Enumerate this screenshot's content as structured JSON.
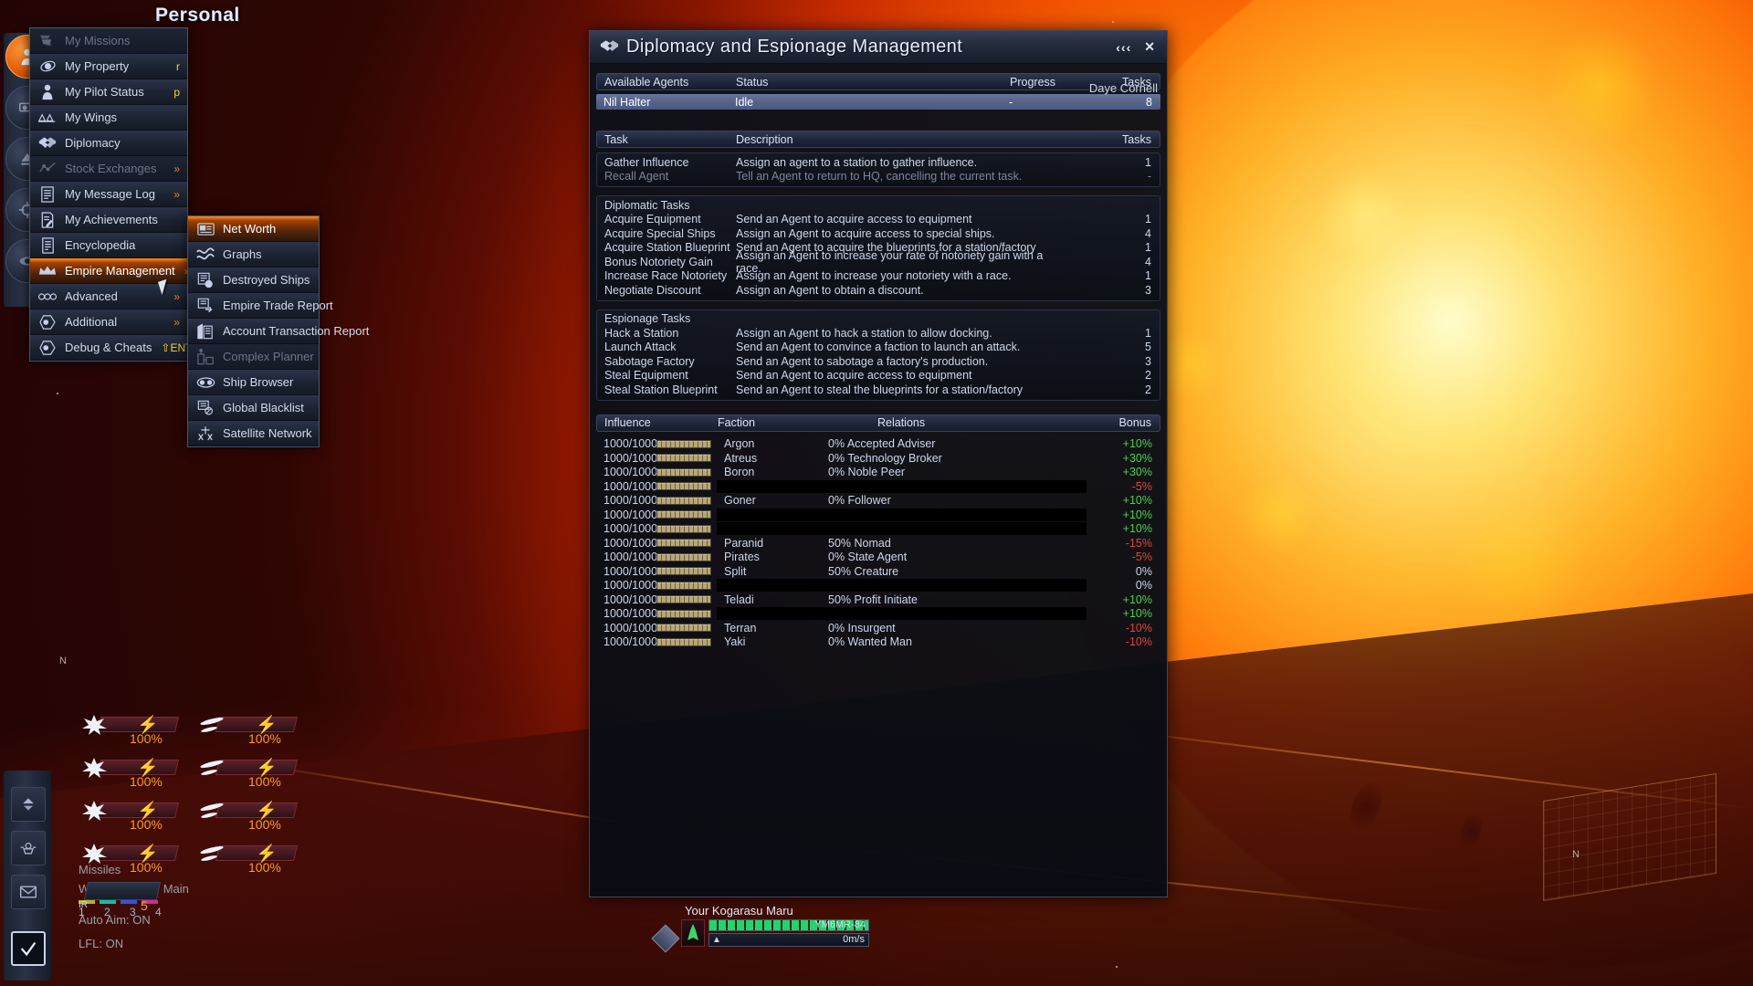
{
  "hud": {
    "personal_title": "Personal",
    "rail_top_icons": [
      "pilot-icon",
      "property-icon",
      "ship-icon",
      "target-icon",
      "galaxy-icon"
    ],
    "rail_bottom_icons": [
      "up-down-icon",
      "satellite-icon",
      "mail-icon",
      "checkbox-icon"
    ],
    "weapons": {
      "group_label": "Weapons",
      "main_label": "Main",
      "cells": [
        {
          "pct": "100%",
          "icon": "impulse-gun-icon"
        },
        {
          "pct": "100%",
          "icon": "beam-gun-icon"
        },
        {
          "pct": "100%",
          "icon": "impulse-gun-icon"
        },
        {
          "pct": "100%",
          "icon": "beam-gun-icon"
        },
        {
          "pct": "100%",
          "icon": "impulse-gun-icon"
        },
        {
          "pct": "100%",
          "icon": "beam-gun-icon"
        },
        {
          "pct": "100%",
          "icon": "impulse-gun-icon"
        },
        {
          "pct": "100%",
          "icon": "beam-gun-icon"
        }
      ],
      "slot_numbers": [
        "1",
        "2",
        "3",
        "4"
      ],
      "slot_colors": [
        "#b6b12a",
        "#1fb9a0",
        "#3a51d8",
        "#cc2e8e"
      ]
    },
    "missiles": {
      "label": "Missiles",
      "type": "IR",
      "count": "5"
    },
    "auto_aim": "Auto Aim: ON",
    "lfl": "LFL: ON",
    "ship": {
      "name": "Your Kogarasu Maru",
      "id": "YM6MR-84",
      "speed": "0m/s"
    },
    "markers": {
      "n_left": "N",
      "n_right": "N"
    }
  },
  "main_menu": {
    "items": [
      {
        "label": "My Missions",
        "icon": "missions-icon",
        "right": "",
        "arrow": "",
        "state": "disabled"
      },
      {
        "label": "My Property",
        "icon": "property-icon",
        "right": "r",
        "arrow": "",
        "state": "normal"
      },
      {
        "label": "My Pilot Status",
        "icon": "pilot-icon",
        "right": "p",
        "arrow": "",
        "state": "normal"
      },
      {
        "label": "My Wings",
        "icon": "wings-icon",
        "right": "",
        "arrow": "",
        "state": "normal"
      },
      {
        "label": "Diplomacy",
        "icon": "handshake-icon",
        "right": "",
        "arrow": "",
        "state": "normal"
      },
      {
        "label": "Stock Exchanges",
        "icon": "chart-icon",
        "right": "",
        "arrow": "»",
        "state": "disabled"
      },
      {
        "label": "My Message Log",
        "icon": "log-icon",
        "right": "",
        "arrow": "»",
        "state": "normal"
      },
      {
        "label": "My Achievements",
        "icon": "achievement-icon",
        "right": "",
        "arrow": "",
        "state": "normal"
      },
      {
        "label": "Encyclopedia",
        "icon": "book-icon",
        "right": "",
        "arrow": "",
        "state": "normal"
      },
      {
        "label": "Empire Management",
        "icon": "crown-icon",
        "right": "",
        "arrow": "»",
        "state": "highlight"
      },
      {
        "label": "Advanced",
        "icon": "dots-icon",
        "right": "",
        "arrow": "»",
        "state": "normal"
      },
      {
        "label": "Additional",
        "icon": "hex-icon",
        "right": "",
        "arrow": "»",
        "state": "normal"
      },
      {
        "label": "Debug & Cheats",
        "icon": "hex-icon",
        "right": "⇧ENTER (TN)",
        "arrow": "",
        "state": "normal"
      }
    ]
  },
  "sub_menu": {
    "items": [
      {
        "label": "Net Worth",
        "icon": "networth-icon",
        "state": "highlight"
      },
      {
        "label": "Graphs",
        "icon": "graphs-icon",
        "state": "normal"
      },
      {
        "label": "Destroyed Ships",
        "icon": "destroyed-icon",
        "state": "normal"
      },
      {
        "label": "Empire Trade Report",
        "icon": "trade-icon",
        "state": "normal"
      },
      {
        "label": "Account Transaction Report",
        "icon": "account-icon",
        "state": "normal"
      },
      {
        "label": "Complex Planner",
        "icon": "complex-icon",
        "state": "disabled"
      },
      {
        "label": "Ship Browser",
        "icon": "shipbrowser-icon",
        "state": "normal"
      },
      {
        "label": "Global Blacklist",
        "icon": "blacklist-icon",
        "state": "normal"
      },
      {
        "label": "Satellite Network",
        "icon": "satellite-icon",
        "state": "normal"
      }
    ]
  },
  "dialog": {
    "title": "Diplomacy and Espionage Management",
    "title_icon": "handshake-icon",
    "collapse_glyph": "‹‹‹",
    "close_glyph": "✕",
    "user": "Daye Cornell",
    "agents": {
      "headers": [
        "Available Agents",
        "Status",
        "Progress",
        "Tasks"
      ],
      "rows": [
        {
          "name": "Nil Halter",
          "status": "Idle",
          "progress": "-",
          "tasks": "8",
          "selected": true
        }
      ]
    },
    "tasks": {
      "headers": [
        "Task",
        "Description",
        "",
        "Tasks"
      ],
      "general": [
        {
          "task": "Gather Influence",
          "desc": "Assign an agent to a station to gather influence.",
          "tasks": "1",
          "dim": false
        },
        {
          "task": "Recall Agent",
          "desc": "Tell an Agent to return to HQ, cancelling the current task.",
          "tasks": "-",
          "dim": true
        }
      ],
      "diplomatic_label": "Diplomatic Tasks",
      "diplomatic": [
        {
          "task": "Acquire Equipment",
          "desc": "Send an Agent to acquire access to equipment",
          "tasks": "1"
        },
        {
          "task": "Acquire Special Ships",
          "desc": "Assign an Agent to acquire access to special ships.",
          "tasks": "4"
        },
        {
          "task": "Acquire Station Blueprint",
          "desc": "Send an Agent to acquire the blueprints for a station/factory",
          "tasks": "1"
        },
        {
          "task": "Bonus Notoriety Gain",
          "desc": "Assign an Agent to increase your rate of notoriety gain with a race.",
          "tasks": "4"
        },
        {
          "task": "Increase Race Notoriety",
          "desc": "Assign an Agent to increase your notoriety with a race.",
          "tasks": "1"
        },
        {
          "task": "Negotiate Discount",
          "desc": "Assign an Agent to obtain a discount.",
          "tasks": "3"
        }
      ],
      "espionage_label": "Espionage Tasks",
      "espionage": [
        {
          "task": "Hack a Station",
          "desc": "Assign an Agent to hack a station to allow docking.",
          "tasks": "1"
        },
        {
          "task": "Launch Attack",
          "desc": "Send an Agent to convince a faction to launch an attack.",
          "tasks": "5"
        },
        {
          "task": "Sabotage Factory",
          "desc": "Send an Agent to sabotage a factory's production.",
          "tasks": "3"
        },
        {
          "task": "Steal Equipment",
          "desc": "Send an Agent to acquire access to equipment",
          "tasks": "2"
        },
        {
          "task": "Steal Station Blueprint",
          "desc": "Send an Agent to steal the blueprints for a station/factory",
          "tasks": "2"
        }
      ]
    },
    "influence": {
      "headers": [
        "Influence",
        "Faction",
        "Relations",
        "Bonus"
      ],
      "rows": [
        {
          "influence": "1000/1000",
          "bar": 100,
          "faction": "Argon",
          "relations": "0% Accepted Adviser",
          "bonus": "+10%",
          "bonus_sign": "pos",
          "redacted": false
        },
        {
          "influence": "1000/1000",
          "bar": 100,
          "faction": "Atreus",
          "relations": "0% Technology Broker",
          "bonus": "+30%",
          "bonus_sign": "pos",
          "redacted": false
        },
        {
          "influence": "1000/1000",
          "bar": 100,
          "faction": "Boron",
          "relations": "0% Noble Peer",
          "bonus": "+30%",
          "bonus_sign": "pos",
          "redacted": false
        },
        {
          "influence": "1000/1000",
          "bar": 100,
          "faction": "",
          "relations": "",
          "bonus": "-5%",
          "bonus_sign": "neg",
          "redacted": true
        },
        {
          "influence": "1000/1000",
          "bar": 100,
          "faction": "Goner",
          "relations": "0% Follower",
          "bonus": "+10%",
          "bonus_sign": "pos",
          "redacted": false
        },
        {
          "influence": "1000/1000",
          "bar": 100,
          "faction": "",
          "relations": "",
          "bonus": "+10%",
          "bonus_sign": "pos",
          "redacted": true
        },
        {
          "influence": "1000/1000",
          "bar": 100,
          "faction": "",
          "relations": "",
          "bonus": "+10%",
          "bonus_sign": "pos",
          "redacted": true
        },
        {
          "influence": "1000/1000",
          "bar": 100,
          "faction": "Paranid",
          "relations": "50% Nomad",
          "bonus": "-15%",
          "bonus_sign": "neg",
          "redacted": false
        },
        {
          "influence": "1000/1000",
          "bar": 100,
          "faction": "Pirates",
          "relations": "0% State Agent",
          "bonus": "-5%",
          "bonus_sign": "neg",
          "redacted": false
        },
        {
          "influence": "1000/1000",
          "bar": 100,
          "faction": "Split",
          "relations": "50% Creature",
          "bonus": "0%",
          "bonus_sign": "zero",
          "redacted": false
        },
        {
          "influence": "1000/1000",
          "bar": 100,
          "faction": "",
          "relations": "",
          "bonus": "0%",
          "bonus_sign": "zero",
          "redacted": true
        },
        {
          "influence": "1000/1000",
          "bar": 100,
          "faction": "Teladi",
          "relations": "50% Profit Initiate",
          "bonus": "+10%",
          "bonus_sign": "pos",
          "redacted": false
        },
        {
          "influence": "1000/1000",
          "bar": 100,
          "faction": "",
          "relations": "",
          "bonus": "+10%",
          "bonus_sign": "pos",
          "redacted": true
        },
        {
          "influence": "1000/1000",
          "bar": 100,
          "faction": "Terran",
          "relations": "0% Insurgent",
          "bonus": "-10%",
          "bonus_sign": "neg",
          "redacted": false
        },
        {
          "influence": "1000/1000",
          "bar": 100,
          "faction": "Yaki",
          "relations": "0% Wanted Man",
          "bonus": "-10%",
          "bonus_sign": "neg",
          "redacted": false
        }
      ]
    }
  },
  "colors": {
    "accent_orange": "#ff8d1c",
    "positive": "#48d24a",
    "negative": "#e2443a",
    "hotkey_yellow": "#ffd52e",
    "panel_bg": "#0d111a",
    "header_bg": "#2e3750"
  }
}
